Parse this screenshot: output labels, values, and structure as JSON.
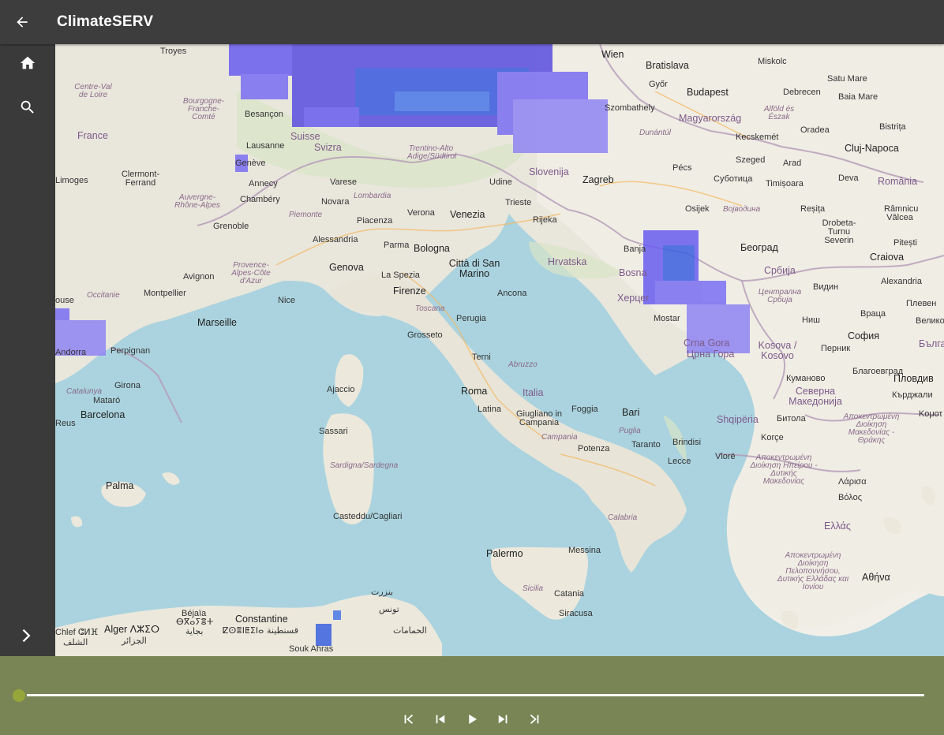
{
  "header": {
    "title": "ClimateSERV"
  },
  "icons": {
    "back": "arrow-left-icon",
    "home": "home-icon",
    "search": "search-icon",
    "collapse": "chevron-right-icon"
  },
  "colors": {
    "topbar": "#3d3d3d",
    "sidebar": "#3a3a3a",
    "timeline_bar": "#7a8555",
    "slider_thumb": "#97a63a",
    "overlay": "#5a4ee0"
  },
  "timeline": {
    "position": 0,
    "controls": [
      "first",
      "previous",
      "play",
      "next",
      "last"
    ]
  },
  "map": {
    "labels": {
      "troyes": "Troyes",
      "wien": "Wien",
      "bratislava": "Bratislava",
      "miskolc": "Miskolc",
      "satu_mare": "Satu Mare",
      "gyor": "Győr",
      "budapest": "Budapest",
      "debrecen": "Debrecen",
      "baia_mare": "Baia Mare",
      "centre_loire": "Centre-Val de Loire",
      "bourgogne": "Bourgogne-Franche-Comté",
      "besancon": "Besançon",
      "magyarorszag": "Magyarország",
      "alfold": "Alföld és Észak",
      "oradea": "Oradea",
      "bistrita": "Bistrița",
      "france": "France",
      "lausanne": "Lausanne",
      "svizra": "Svizra",
      "suisse": "Suisse",
      "trentino": "Trentino-Alto Adige/Südtirol",
      "dunantul": "Dunántúl",
      "kecskemet": "Kecskemét",
      "cluj": "Cluj-Napoca",
      "geneve": "Genève",
      "szombathely": "Szombathely",
      "szeged": "Szeged",
      "arad": "Arad",
      "clermont": "Clermont-Ferrand",
      "annecy": "Annecy",
      "slovenija": "Slovenija",
      "pecs": "Pécs",
      "subotica": "Суботица",
      "timisoara": "Timișoara",
      "deva": "Deva",
      "romania": "România",
      "limoges": "Limoges",
      "varese": "Varese",
      "udine": "Udine",
      "zagreb": "Zagreb",
      "auvergne": "Auvergne-Rhône-Alpes",
      "chambery": "Chambéry",
      "lombardia": "Lombardia",
      "novara": "Novara",
      "trieste": "Trieste",
      "osijek": "Osijek",
      "vojvodina": "Војводина",
      "resita": "Reșița",
      "ramnicu": "Râmnicu Vâlcea",
      "piemonte": "Piemonte",
      "verona": "Verona",
      "venezia": "Venezia",
      "rijeka": "Rijeka",
      "drobeta": "Drobeta-Turnu Severin",
      "pitesti": "Pitești",
      "grenoble": "Grenoble",
      "piacenza": "Piacenza",
      "alessandria": "Alessandria",
      "parma": "Parma",
      "bologna": "Bologna",
      "banja": "Banja",
      "beograd": "Београд",
      "craiova": "Craiova",
      "provence": "Provence-Alpes-Côte d'Azur",
      "genova": "Genova",
      "la_spezia": "La Spezia",
      "san_marino": "Città di San Marino",
      "hrvatska": "Hrvatska",
      "bosna": "Bosna",
      "srbija": "Србија",
      "alexandria": "Alexandria",
      "avignon": "Avignon",
      "vidin": "Видин",
      "pleven": "Плевен",
      "montpellier": "Montpellier",
      "occitanie": "Occitanie",
      "nice": "Nice",
      "firenze": "Firenze",
      "ancona": "Ancona",
      "herceg": "Херцег",
      "centralna_srbija": "Централна Србија",
      "toulouse": "ouse",
      "marseille": "Marseille",
      "toscana": "Toscana",
      "perugia": "Perugia",
      "mostar": "Mostar",
      "nis": "Ниш",
      "vraca": "Враца",
      "veliko": "Велико",
      "perpignan": "Perpignan",
      "grosseto": "Grosseto",
      "crna_gora": "Crna Gora",
      "crna_gora_cyr": "Црна Гора",
      "kosova": "Kosova / Kosovo",
      "pernik": "Перник",
      "sofia": "София",
      "balgaria": "Българ",
      "andorra": "Andorra",
      "terni": "Terni",
      "abruzzo": "Abruzzo",
      "kumanovo": "Куманово",
      "blagoevgrad": "Благоевград",
      "plovdiv": "Пловдив",
      "catalunya": "Catalunya",
      "girona": "Girona",
      "ajaccio": "Ajaccio",
      "roma": "Roma",
      "italia": "Italia",
      "severna": "Северна Македонија",
      "kardzhali": "Кърджали",
      "mataro": "Mataró",
      "barcelona": "Barcelona",
      "latina": "Latina",
      "foggia": "Foggia",
      "bari": "Bari",
      "bitola": "Битола",
      "komotini": "Κομοτ",
      "reus": "Reus",
      "giugliano": "Giugliano in Campania",
      "campania": "Campania",
      "puglia": "Puglia",
      "brindisi": "Brindisi",
      "shqiperia": "Shqipëria",
      "makedonia": "Αποκεντρωμένη Διοίκηση Μακεδονίας - Θράκης",
      "sassari": "Sassari",
      "potenza": "Potenza",
      "taranto": "Taranto",
      "lecce": "Lecce",
      "korce": "Korçe",
      "vlore": "Vlorë",
      "palma": "Palma",
      "sardegna": "Sardigna/Sardegna",
      "ipeiros": "Αποκεντρωμένη Διοίκηση Ηπείρου - Δυτικής Μακεδονίας",
      "larisa": "Λάρισα",
      "volos": "Βόλος",
      "cagliari": "Casteddu/Cagliari",
      "calabria": "Calabria",
      "ellas": "Ελλάς",
      "messina": "Messina",
      "palermo": "Palermo",
      "peloponnisos": "Αποκεντρωμένη Διοίκηση Πελοποννήσου, Δυτικής Ελλάδας και Ιονίου",
      "athina": "Αθήνα",
      "sicilia": "Sicilia",
      "catania": "Catania",
      "bizerte": "بنزرت",
      "tunis": "تونس",
      "bejaia": "Béjaïa",
      "constantine": "Constantine",
      "siracusa": "Siracusa",
      "alger": "Alger ⴷⵣⵉⵔ",
      "bjaya": "ⴱⴳⴰⵢⴻⵜ",
      "bejaia_ar": "بجاية",
      "qsantina": "ⵇⵙⴻⵏⵟⵉⵏⴰ",
      "qsantina_ar": "قسنطينة",
      "hammamet": "الحمامات",
      "chlef": "Chlef ⵛⵍⴼ",
      "chlef_ar": "الشلف",
      "jazair": "الجزائر",
      "souk_ahras": "Souk Ahras"
    }
  }
}
